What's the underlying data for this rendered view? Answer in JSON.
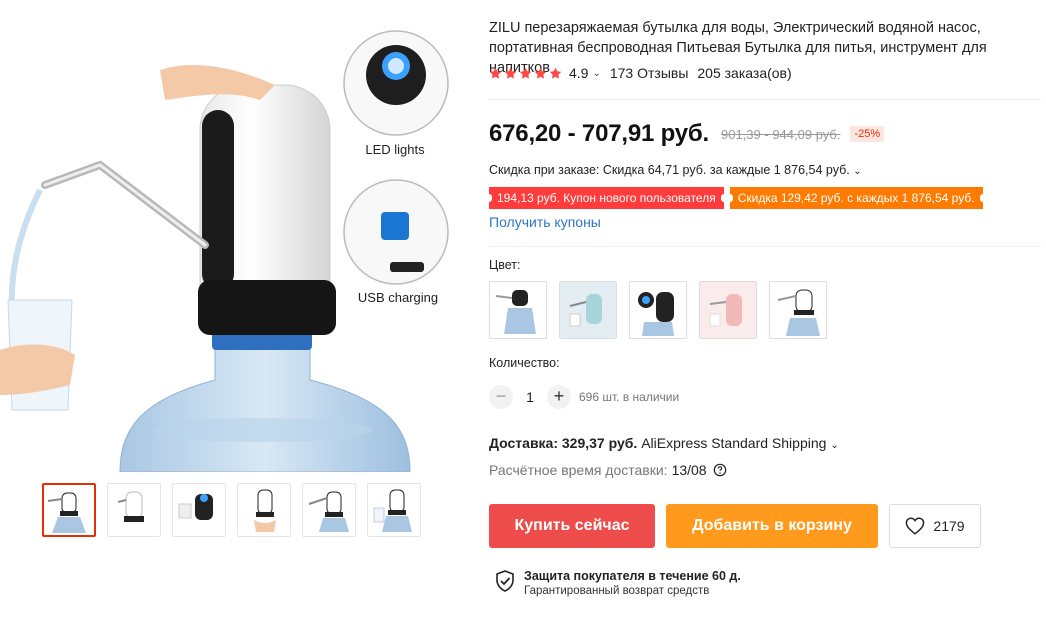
{
  "gallery": {
    "main_image_labels": {
      "led": "LED lights",
      "usb": "USB charging"
    },
    "thumbnail_count": 6
  },
  "product": {
    "title": "ZILU перезаряжаемая бутылка для воды, Электрический водяной насос, портативная беспроводная Питьевая Бутылка для питья, инструмент для напитков",
    "rating": "4.9",
    "reviews": "173 Отзывы",
    "orders": "205 заказа(ов)",
    "price": "676,20 - 707,91 руб.",
    "old_price": "901,39 - 944,09 руб.",
    "discount": "-25%",
    "order_discount": "Скидка при заказе: Скидка 64,71 руб. за каждые 1 876,54 руб.",
    "coupons": [
      "194,13 руб. Купон нового пользователя",
      "Скидка 129,42 руб. с каждых 1 876,54 руб."
    ],
    "get_coupons": "Получить купоны",
    "color_label": "Цвет:",
    "quantity_label": "Количество:",
    "quantity": "1",
    "stock": "696 шт. в наличии",
    "shipping_label": "Доставка: 329,37 руб.",
    "shipping_method": "AliExpress Standard Shipping",
    "delivery_label": "Расчётное время доставки:",
    "delivery_date": "13/08",
    "buy_now": "Купить сейчас",
    "add_to_cart": "Добавить в корзину",
    "wishlist_count": "2179",
    "protection_title": "Защита покупателя в течение 60 д.",
    "protection_sub": "Гарантированный возврат средств"
  },
  "colors": {
    "star": "#ff4747",
    "buy": "#ee4b4b",
    "cart": "#ff9a1c",
    "link": "#2e76c6",
    "coupon_red": "#ff3b3b",
    "coupon_orange": "#ff7a00"
  }
}
